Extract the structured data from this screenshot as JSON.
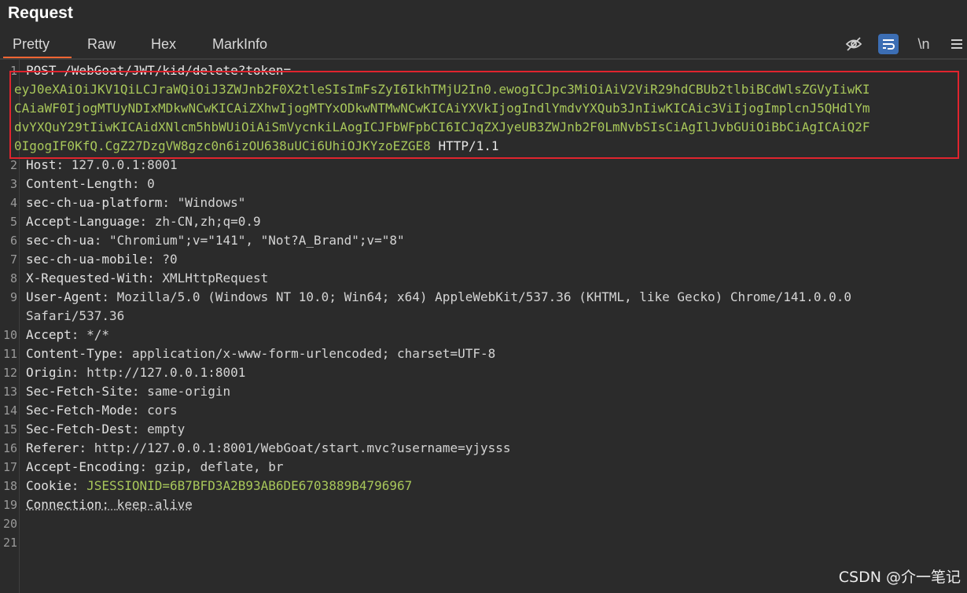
{
  "panel": {
    "title": "Request"
  },
  "tabs": [
    {
      "label": "Pretty",
      "active": true
    },
    {
      "label": "Raw"
    },
    {
      "label": "Hex"
    },
    {
      "label": "MarkInfo"
    }
  ],
  "toolbar": {
    "icons": [
      "eye-off-icon",
      "wrap-icon",
      "newline-icon",
      "menu-icon"
    ],
    "newline_label": "\\n",
    "accent": "#3c6eb4"
  },
  "request": {
    "line1": "POST /WebGoat/JWT/kid/delete?token=",
    "token_lines": [
      "eyJ0eXAiOiJKV1QiLCJraWQiOiJ3ZWJnb2F0X2tleSIsImFsZyI6IkhTMjU2In0.ewogICJpc3MiOiAiV2ViR29hdCBUb2tlbiBCdWlsZGVyIiwKI",
      "CAiaWF0IjogMTUyNDIxMDkwNCwKICAiZXhwIjogMTYxODkwNTMwNCwKICAiYXVkIjogIndlYmdvYXQub3JnIiwKICAic3ViIjogImplcnJ5QHdlYm",
      "dvYXQuY29tIiwKICAidXNlcm5hbWUiOiAiSmVycnkiLAogICJFbWFpbCI6ICJqZXJyeUB3ZWJnb2F0LmNvbSIsCiAgIlJvbGUiOiBbCiAgICAiQ2F",
      "0IgogIF0KfQ.CgZ27DzgVW8gzc0n6izOU638uUCi6UhiOJKYzoEZGE8"
    ],
    "protocol": "HTTP/1.1",
    "line_numbers": [
      "1",
      "2",
      "3",
      "4",
      "5",
      "6",
      "7",
      "8",
      "9",
      "10",
      "11",
      "12",
      "13",
      "14",
      "15",
      "16",
      "17",
      "18",
      "19",
      "20",
      "21"
    ],
    "headers": [
      {
        "k": "Host",
        "v": "127.0.0.1:8001"
      },
      {
        "k": "Content-Length",
        "v": "0"
      },
      {
        "k": "sec-ch-ua-platform",
        "v": "\"Windows\""
      },
      {
        "k": "Accept-Language",
        "v": "zh-CN,zh;q=0.9"
      },
      {
        "k": "sec-ch-ua",
        "v": "\"Chromium\";v=\"141\", \"Not?A_Brand\";v=\"8\""
      },
      {
        "k": "sec-ch-ua-mobile",
        "v": "?0"
      },
      {
        "k": "X-Requested-With",
        "v": "XMLHttpRequest"
      },
      {
        "k": "User-Agent",
        "v": "Mozilla/5.0 (Windows NT 10.0; Win64; x64) AppleWebKit/537.36 (KHTML, like Gecko) Chrome/141.0.0.0"
      },
      {
        "k": "",
        "v": "Safari/537.36"
      },
      {
        "k": "Accept",
        "v": "*/*"
      },
      {
        "k": "Content-Type",
        "v": "application/x-www-form-urlencoded; charset=UTF-8"
      },
      {
        "k": "Origin",
        "v": "http://127.0.0.1:8001"
      },
      {
        "k": "Sec-Fetch-Site",
        "v": "same-origin"
      },
      {
        "k": "Sec-Fetch-Mode",
        "v": "cors"
      },
      {
        "k": "Sec-Fetch-Dest",
        "v": "empty"
      },
      {
        "k": "Referer",
        "v": "http://127.0.0.1:8001/WebGoat/start.mvc?username=yjysss"
      },
      {
        "k": "Accept-Encoding",
        "v": "gzip, deflate, br"
      },
      {
        "k": "Cookie",
        "v": "JSESSIONID=6B7BFD3A2B93AB6DE6703889B4796967",
        "cookie_name": "JSESSIONID=",
        "cookie_value": "6B7BFD3A2B93AB6DE6703889B4796967"
      },
      {
        "k": "Connection",
        "v": "keep-alive"
      }
    ],
    "highlight_color": "#e0242e"
  },
  "watermark": "CSDN @介一笔记"
}
